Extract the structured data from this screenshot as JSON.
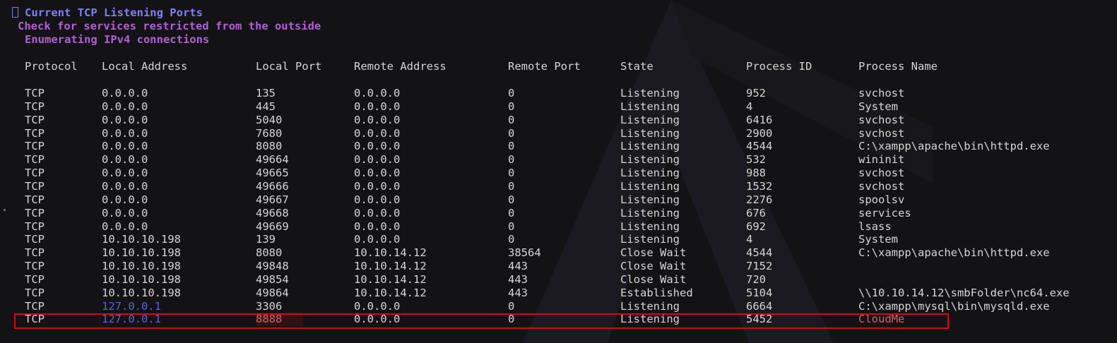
{
  "terminal": {
    "section_title": "Current TCP Listening Ports",
    "subtitle": "Check for services restricted from the outside",
    "subsection": "Enumerating IPv4 connections",
    "colors": {
      "title": "#7f7ff5",
      "subtitle": "#b35ed6",
      "highlight_address": "#5561e6",
      "highlight_red": "#c86a6a",
      "box_border": "#d30b0b"
    }
  },
  "table": {
    "headers": [
      "Protocol",
      "Local Address",
      "Local Port",
      "Remote Address",
      "Remote Port",
      "State",
      "Process ID",
      "Process Name"
    ],
    "rows": [
      [
        "TCP",
        "0.0.0.0",
        "135",
        "0.0.0.0",
        "0",
        "Listening",
        "952",
        "svchost"
      ],
      [
        "TCP",
        "0.0.0.0",
        "445",
        "0.0.0.0",
        "0",
        "Listening",
        "4",
        "System"
      ],
      [
        "TCP",
        "0.0.0.0",
        "5040",
        "0.0.0.0",
        "0",
        "Listening",
        "6416",
        "svchost"
      ],
      [
        "TCP",
        "0.0.0.0",
        "7680",
        "0.0.0.0",
        "0",
        "Listening",
        "2900",
        "svchost"
      ],
      [
        "TCP",
        "0.0.0.0",
        "8080",
        "0.0.0.0",
        "0",
        "Listening",
        "4544",
        "C:\\xampp\\apache\\bin\\httpd.exe"
      ],
      [
        "TCP",
        "0.0.0.0",
        "49664",
        "0.0.0.0",
        "0",
        "Listening",
        "532",
        "wininit"
      ],
      [
        "TCP",
        "0.0.0.0",
        "49665",
        "0.0.0.0",
        "0",
        "Listening",
        "988",
        "svchost"
      ],
      [
        "TCP",
        "0.0.0.0",
        "49666",
        "0.0.0.0",
        "0",
        "Listening",
        "1532",
        "svchost"
      ],
      [
        "TCP",
        "0.0.0.0",
        "49667",
        "0.0.0.0",
        "0",
        "Listening",
        "2276",
        "spoolsv"
      ],
      [
        "TCP",
        "0.0.0.0",
        "49668",
        "0.0.0.0",
        "0",
        "Listening",
        "676",
        "services"
      ],
      [
        "TCP",
        "0.0.0.0",
        "49669",
        "0.0.0.0",
        "0",
        "Listening",
        "692",
        "lsass"
      ],
      [
        "TCP",
        "10.10.10.198",
        "139",
        "0.0.0.0",
        "0",
        "Listening",
        "4",
        "System"
      ],
      [
        "TCP",
        "10.10.10.198",
        "8080",
        "10.10.14.12",
        "38564",
        "Close Wait",
        "4544",
        "C:\\xampp\\apache\\bin\\httpd.exe"
      ],
      [
        "TCP",
        "10.10.10.198",
        "49848",
        "10.10.14.12",
        "443",
        "Close Wait",
        "7152",
        ""
      ],
      [
        "TCP",
        "10.10.10.198",
        "49854",
        "10.10.14.12",
        "443",
        "Close Wait",
        "720",
        ""
      ],
      [
        "TCP",
        "10.10.10.198",
        "49864",
        "10.10.14.12",
        "443",
        "Established",
        "5104",
        "\\\\10.10.14.12\\smbFolder\\nc64.exe"
      ],
      [
        "TCP",
        "127.0.0.1",
        "3306",
        "0.0.0.0",
        "0",
        "Listening",
        "6664",
        "C:\\xampp\\mysql\\bin\\mysqld.exe"
      ],
      [
        "TCP",
        "127.0.0.1",
        "8888",
        "0.0.0.0",
        "0",
        "Listening",
        "5452",
        "CloudMe"
      ]
    ]
  }
}
